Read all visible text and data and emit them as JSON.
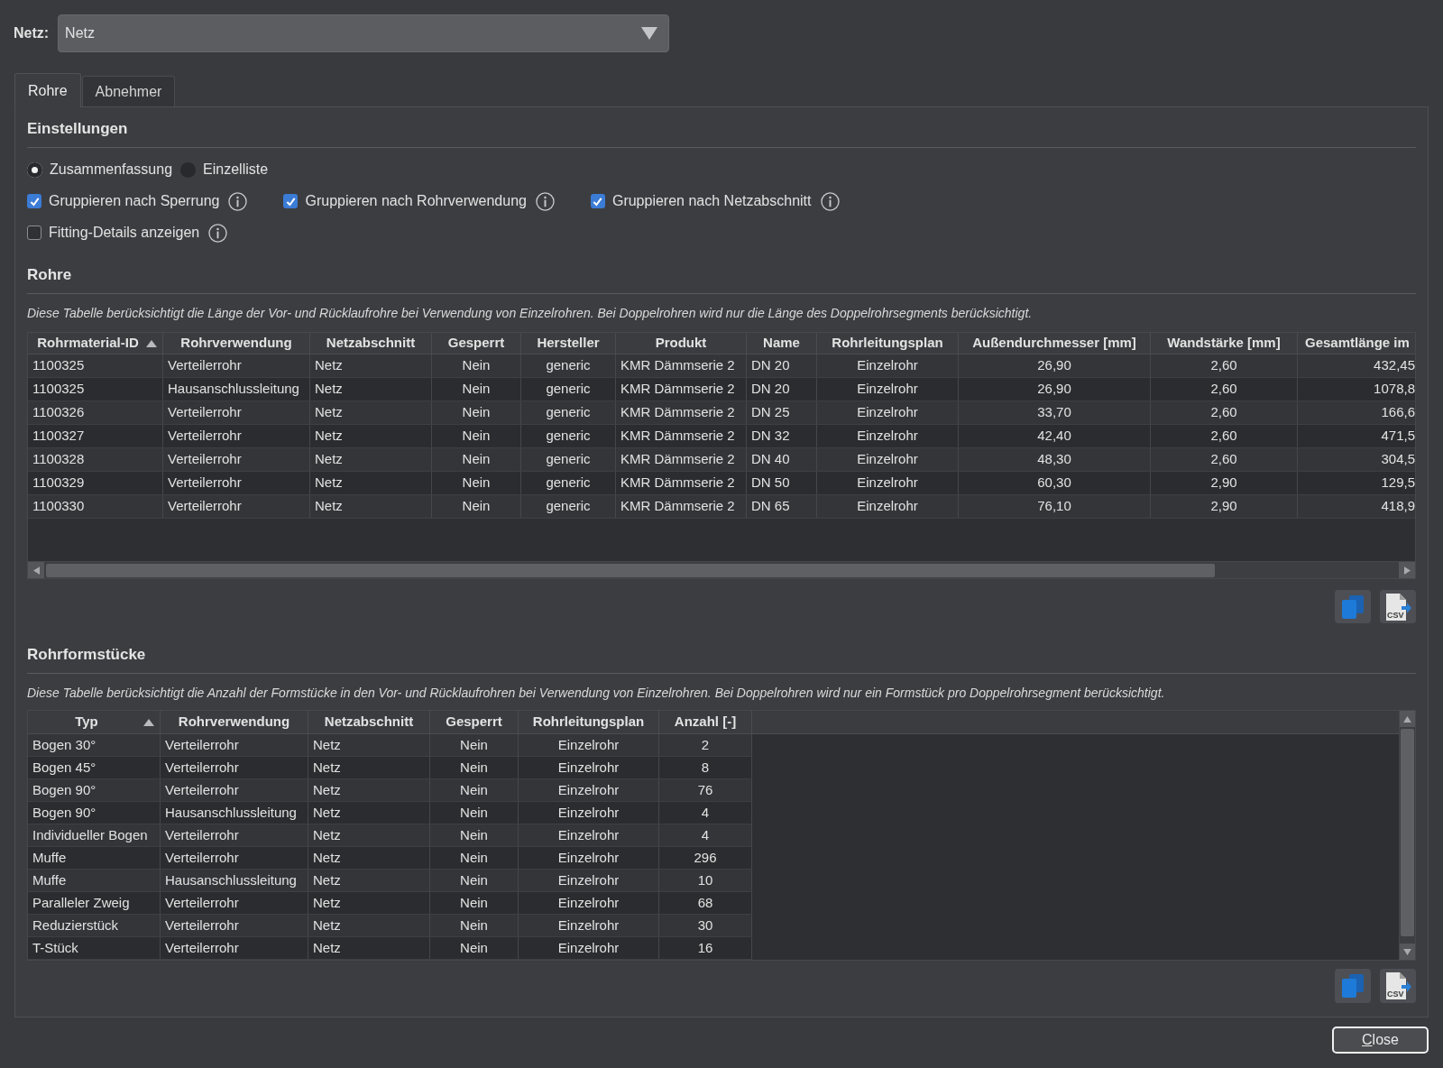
{
  "network": {
    "label": "Netz:",
    "value": "Netz"
  },
  "tabs": [
    {
      "label": "Rohre",
      "selected": true
    },
    {
      "label": "Abnehmer",
      "selected": false
    }
  ],
  "settings": {
    "title": "Einstellungen",
    "view_options": [
      {
        "label": "Zusammenfassung",
        "selected": true
      },
      {
        "label": "Einzelliste",
        "selected": false
      }
    ],
    "checkboxes": [
      {
        "label": "Gruppieren nach Sperrung",
        "checked": true
      },
      {
        "label": "Gruppieren nach Rohrverwendung",
        "checked": true
      },
      {
        "label": "Gruppieren nach Netzabschnitt",
        "checked": true
      },
      {
        "label": "Fitting-Details anzeigen",
        "checked": false
      }
    ]
  },
  "pipes": {
    "title": "Rohre",
    "description": "Diese Tabelle berücksichtigt die Länge der Vor- und Rücklaufrohre bei Verwendung von Einzelrohren. Bei Doppelrohren wird nur die Länge des Doppelrohrsegments berücksichtigt.",
    "columns": [
      {
        "label": "Rohrmaterial-ID",
        "sorted_ascending": true
      },
      {
        "label": "Rohrverwendung",
        "sorted_ascending": false
      },
      {
        "label": "Netzabschnitt",
        "sorted_ascending": false
      },
      {
        "label": "Gesperrt",
        "sorted_ascending": false
      },
      {
        "label": "Hersteller",
        "sorted_ascending": false
      },
      {
        "label": "Produkt",
        "sorted_ascending": false
      },
      {
        "label": "Name",
        "sorted_ascending": false
      },
      {
        "label": "Rohrleitungsplan",
        "sorted_ascending": false
      },
      {
        "label": "Außendurchmesser [mm]",
        "sorted_ascending": false
      },
      {
        "label": "Wandstärke [mm]",
        "sorted_ascending": false
      },
      {
        "label": "Gesamtlänge im",
        "sorted_ascending": false
      }
    ],
    "rows": [
      [
        "1100325",
        "Verteilerrohr",
        "Netz",
        "Nein",
        "generic",
        "KMR Dämmserie 2",
        "DN 20",
        "Einzelrohr",
        "26,90",
        "2,60",
        "432,45"
      ],
      [
        "1100325",
        "Hausanschlussleitung",
        "Netz",
        "Nein",
        "generic",
        "KMR Dämmserie 2",
        "DN 20",
        "Einzelrohr",
        "26,90",
        "2,60",
        "1078,8"
      ],
      [
        "1100326",
        "Verteilerrohr",
        "Netz",
        "Nein",
        "generic",
        "KMR Dämmserie 2",
        "DN 25",
        "Einzelrohr",
        "33,70",
        "2,60",
        "166,6"
      ],
      [
        "1100327",
        "Verteilerrohr",
        "Netz",
        "Nein",
        "generic",
        "KMR Dämmserie 2",
        "DN 32",
        "Einzelrohr",
        "42,40",
        "2,60",
        "471,5"
      ],
      [
        "1100328",
        "Verteilerrohr",
        "Netz",
        "Nein",
        "generic",
        "KMR Dämmserie 2",
        "DN 40",
        "Einzelrohr",
        "48,30",
        "2,60",
        "304,5"
      ],
      [
        "1100329",
        "Verteilerrohr",
        "Netz",
        "Nein",
        "generic",
        "KMR Dämmserie 2",
        "DN 50",
        "Einzelrohr",
        "60,30",
        "2,90",
        "129,5"
      ],
      [
        "1100330",
        "Verteilerrohr",
        "Netz",
        "Nein",
        "generic",
        "KMR Dämmserie 2",
        "DN 65",
        "Einzelrohr",
        "76,10",
        "2,90",
        "418,9"
      ]
    ],
    "actions": [
      {
        "kind": "copy"
      },
      {
        "kind": "csv",
        "icon_text": "CSV"
      }
    ]
  },
  "fittings": {
    "title": "Rohrformstücke",
    "description": "Diese Tabelle berücksichtigt die Anzahl der Formstücke in den Vor- und Rücklaufrohren bei Verwendung von Einzelrohren. Bei Doppelrohren wird nur ein Formstück pro Doppelrohrsegment berücksichtigt.",
    "columns": [
      {
        "label": "Typ",
        "sorted_ascending": true
      },
      {
        "label": "Rohrverwendung",
        "sorted_ascending": false
      },
      {
        "label": "Netzabschnitt",
        "sorted_ascending": false
      },
      {
        "label": "Gesperrt",
        "sorted_ascending": false
      },
      {
        "label": "Rohrleitungsplan",
        "sorted_ascending": false
      },
      {
        "label": "Anzahl [-]",
        "sorted_ascending": false
      }
    ],
    "rows": [
      [
        "Bogen 30°",
        "Verteilerrohr",
        "Netz",
        "Nein",
        "Einzelrohr",
        "2"
      ],
      [
        "Bogen 45°",
        "Verteilerrohr",
        "Netz",
        "Nein",
        "Einzelrohr",
        "8"
      ],
      [
        "Bogen 90°",
        "Verteilerrohr",
        "Netz",
        "Nein",
        "Einzelrohr",
        "76"
      ],
      [
        "Bogen 90°",
        "Hausanschlussleitung",
        "Netz",
        "Nein",
        "Einzelrohr",
        "4"
      ],
      [
        "Individueller Bogen",
        "Verteilerrohr",
        "Netz",
        "Nein",
        "Einzelrohr",
        "4"
      ],
      [
        "Muffe",
        "Verteilerrohr",
        "Netz",
        "Nein",
        "Einzelrohr",
        "296"
      ],
      [
        "Muffe",
        "Hausanschlussleitung",
        "Netz",
        "Nein",
        "Einzelrohr",
        "10"
      ],
      [
        "Paralleler Zweig",
        "Verteilerrohr",
        "Netz",
        "Nein",
        "Einzelrohr",
        "68"
      ],
      [
        "Reduzierstück",
        "Verteilerrohr",
        "Netz",
        "Nein",
        "Einzelrohr",
        "30"
      ],
      [
        "T-Stück",
        "Verteilerrohr",
        "Netz",
        "Nein",
        "Einzelrohr",
        "16"
      ]
    ],
    "actions": [
      {
        "kind": "copy"
      },
      {
        "kind": "csv",
        "icon_text": "CSV"
      }
    ]
  },
  "close_button": {
    "label": "Close",
    "mnemonic_underlined": true
  }
}
